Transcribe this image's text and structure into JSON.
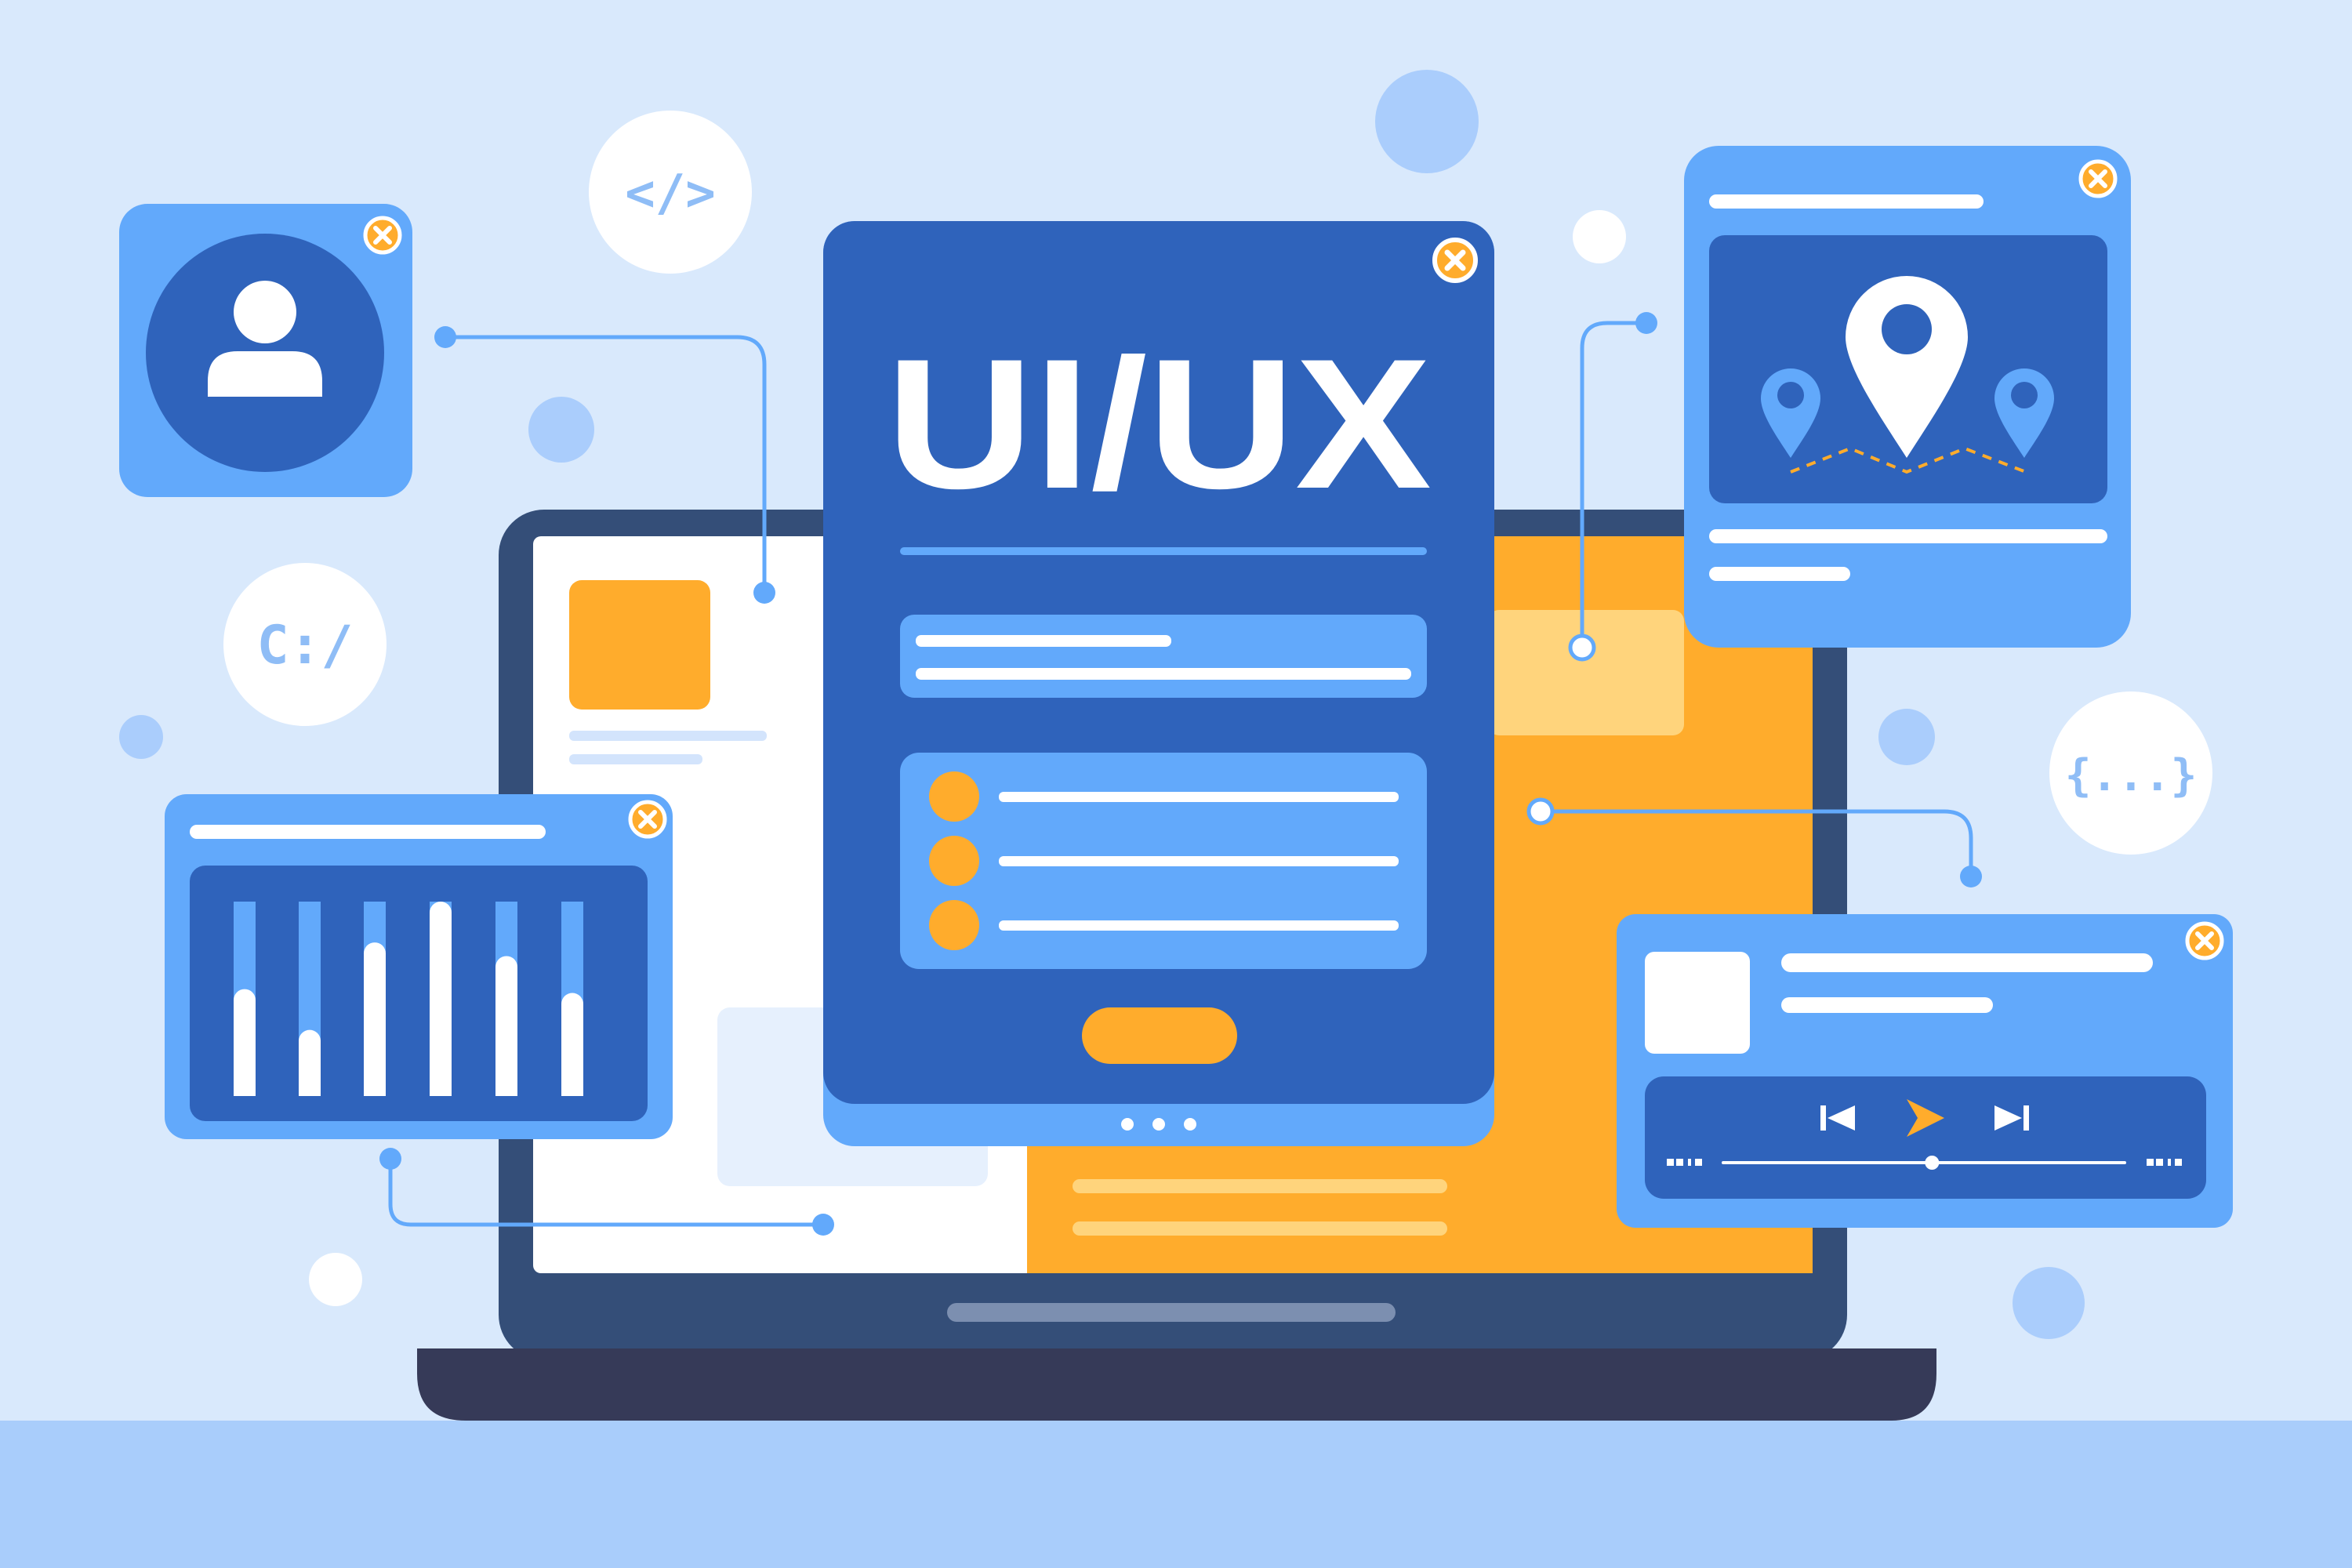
{
  "hero": {
    "title": "UI/UX"
  },
  "badges": {
    "code": "</>",
    "path": "C:/",
    "braces": "{...}"
  },
  "colors": {
    "background": "#d9e9fc",
    "floor": "#a9cdfb",
    "laptop_body": "#344e78",
    "laptop_base": "#363a58",
    "primary_blue": "#2f63bb",
    "light_blue": "#62a9fb",
    "accent_orange": "#ffac2c",
    "white": "#ffffff"
  },
  "windows": {
    "profile": {
      "icon": "user-icon"
    },
    "chart": {
      "icon": "bar-chart-icon",
      "bar_levels": [
        0.55,
        0.34,
        0.79,
        1.0,
        0.72,
        0.53
      ]
    },
    "map": {
      "icon": "map-pin-icon"
    },
    "media_player": {
      "icons": [
        "previous-icon",
        "play-icon",
        "next-icon"
      ],
      "progress": 0.52
    }
  }
}
